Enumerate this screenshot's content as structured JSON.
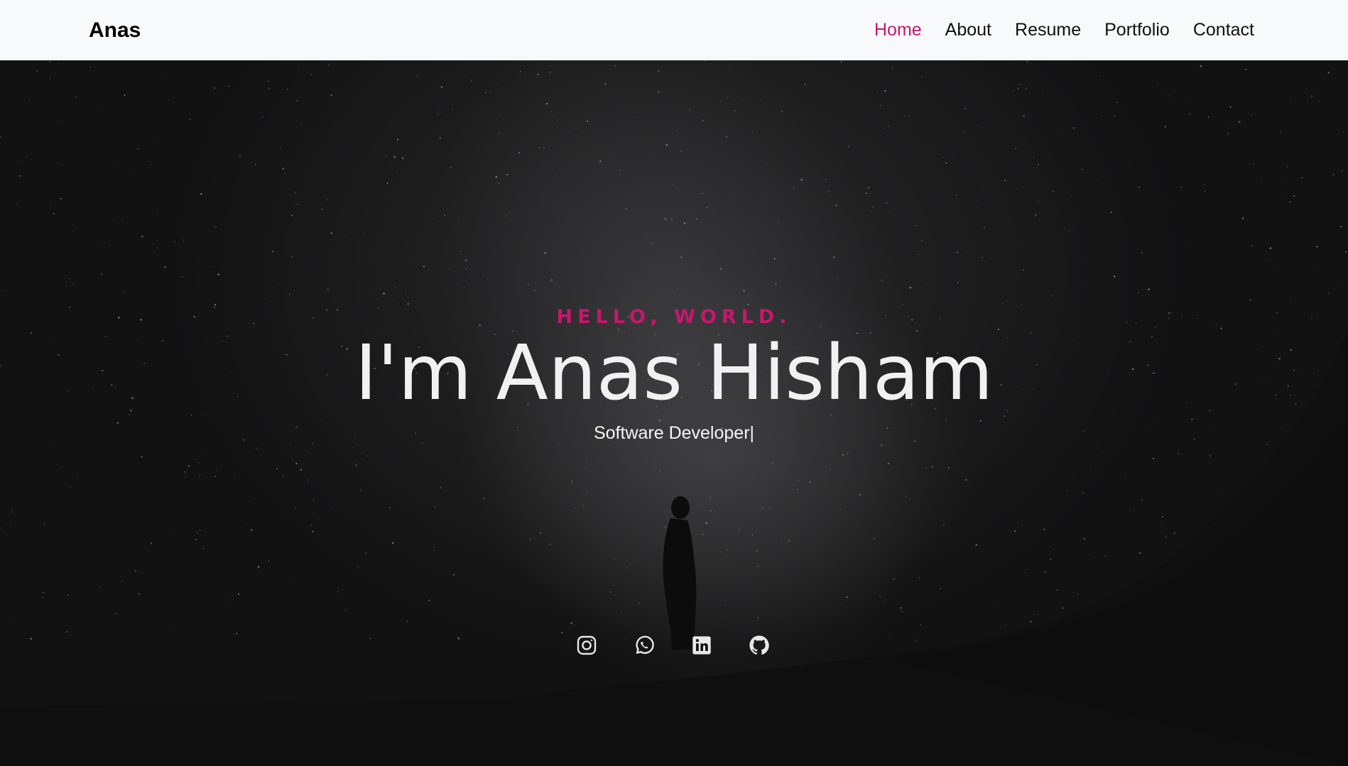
{
  "navbar": {
    "brand": "Anas",
    "links": [
      {
        "label": "Home",
        "active": true
      },
      {
        "label": "About",
        "active": false
      },
      {
        "label": "Resume",
        "active": false
      },
      {
        "label": "Portfolio",
        "active": false
      },
      {
        "label": "Contact",
        "active": false
      }
    ]
  },
  "hero": {
    "greeting": "HELLO, WORLD.",
    "title": "I'm Anas Hisham",
    "subtitle": "Software Developer|"
  },
  "socials": [
    {
      "icon": "instagram-icon"
    },
    {
      "icon": "whatsapp-icon"
    },
    {
      "icon": "linkedin-icon"
    },
    {
      "icon": "github-icon"
    }
  ],
  "colors": {
    "accent": "#c8166d",
    "navbar_bg": "#f8f9fa",
    "hero_bg": "#121213",
    "text_light": "#f1f1f1"
  }
}
